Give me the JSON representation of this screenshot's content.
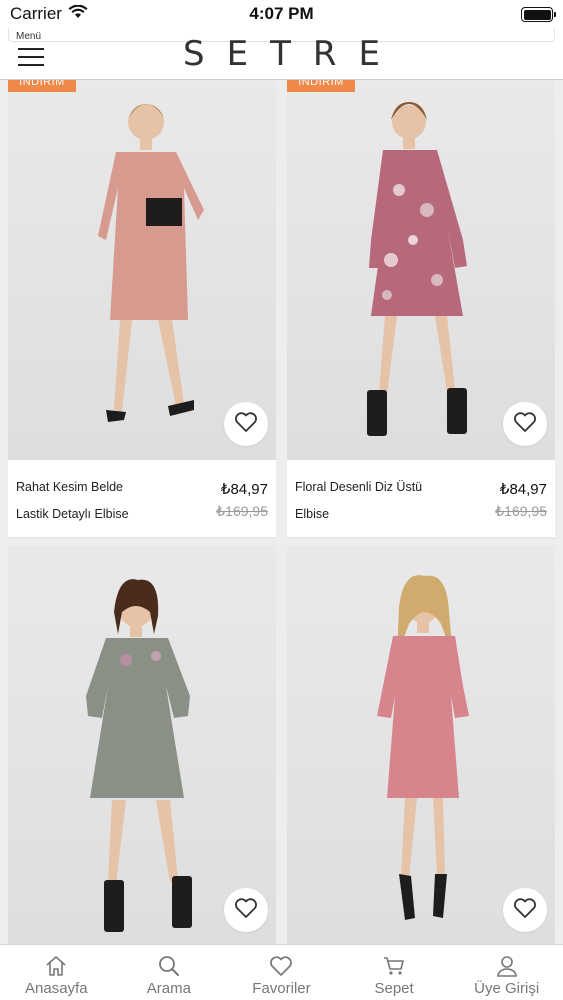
{
  "status_bar": {
    "carrier": "Carrier",
    "time": "4:07 PM"
  },
  "header": {
    "menu_label": "Menü",
    "brand": "SETRE"
  },
  "products": [
    {
      "name_line1": "Rahat Kesim Belde",
      "name_line2": "Lastik Detaylı Elbise",
      "price": "₺84,97",
      "old_price": "₺169,95",
      "dress_color": "#d79a8f",
      "badge": "İNDİRİM"
    },
    {
      "name_line1": "Floral Desenli Diz Üstü",
      "name_line2": "Elbise",
      "price": "₺84,97",
      "old_price": "₺169,95",
      "dress_color": "#b7697b",
      "badge": "İNDİRİM"
    },
    {
      "dress_color": "#8a9086"
    },
    {
      "dress_color": "#d7848c"
    }
  ],
  "tabbar": {
    "items": [
      {
        "label": "Anasayfa",
        "icon": "home-icon"
      },
      {
        "label": "Arama",
        "icon": "search-icon"
      },
      {
        "label": "Favoriler",
        "icon": "heart-icon"
      },
      {
        "label": "Sepet",
        "icon": "cart-icon"
      },
      {
        "label": "Üye Girişi",
        "icon": "user-icon"
      }
    ]
  },
  "colors": {
    "accent_badge": "#f0884a",
    "tab_label": "#777777"
  }
}
